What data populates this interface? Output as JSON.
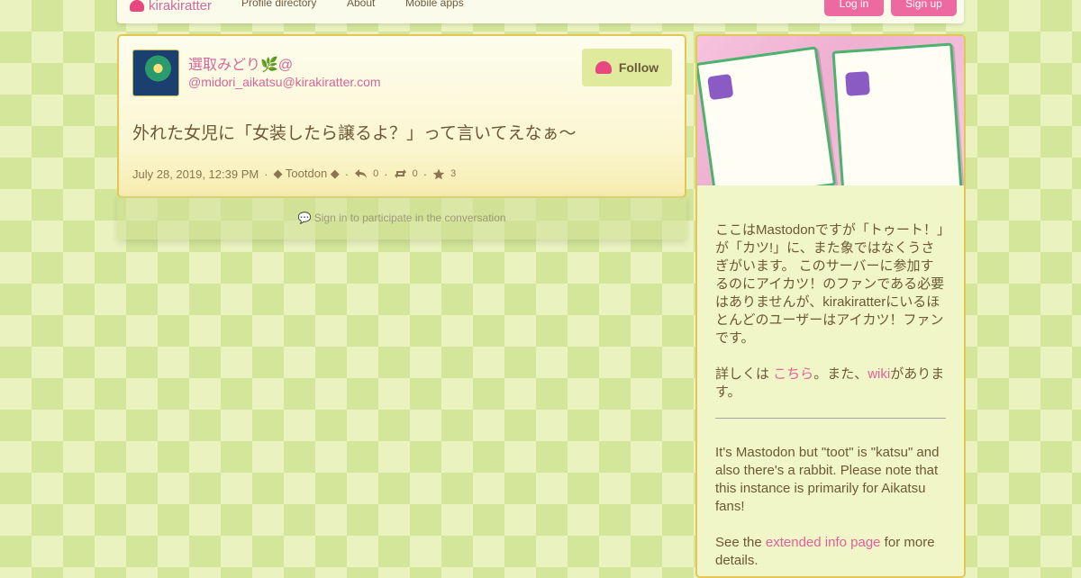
{
  "header": {
    "brand": "kirakiratter",
    "nav": [
      "Profile directory",
      "About",
      "Mobile apps"
    ],
    "login": "Log in",
    "signup": "Sign up"
  },
  "status": {
    "display_name": "選取みどり🌿@",
    "handle": "@midori_aikatsu@kirakiratter.com",
    "follow": "Follow",
    "content": "外れた女児に「女装したら譲るよ？」って言いてえなぁ〜",
    "date": "July 28, 2019, 12:39 PM",
    "separator": "·",
    "app": "◆ Tootdon ◆",
    "replies": "0",
    "boosts": "0",
    "favourites": "3"
  },
  "signin_notice": "Sign in to participate in the conversation",
  "sidebar": {
    "about_ja": "ここはMastodonですが「トゥート！」が「カツ!」に、また象ではなくうさぎがいます。 このサーバーに参加するのにアイカツ！のファンである必要はありませんが、kirakiratterにいるほとんどのユーザーはアイカツ！ファンです。",
    "more_ja_prefix": "詳しくは ",
    "more_ja_link1": "こちら",
    "more_ja_mid": "。また、",
    "more_ja_link2": "wiki",
    "more_ja_suffix": "があります。",
    "about_en": "It's Mastodon but \"toot\" is \"katsu\" and also there's a rabbit. Please note that this instance is primarily for Aikatsu fans!",
    "more_en_prefix": "See the ",
    "more_en_link": "extended info page",
    "more_en_suffix": " for more details."
  },
  "colors": {
    "accent": "#e2609a",
    "border": "#e3c656",
    "background": "#eaf3bf"
  }
}
